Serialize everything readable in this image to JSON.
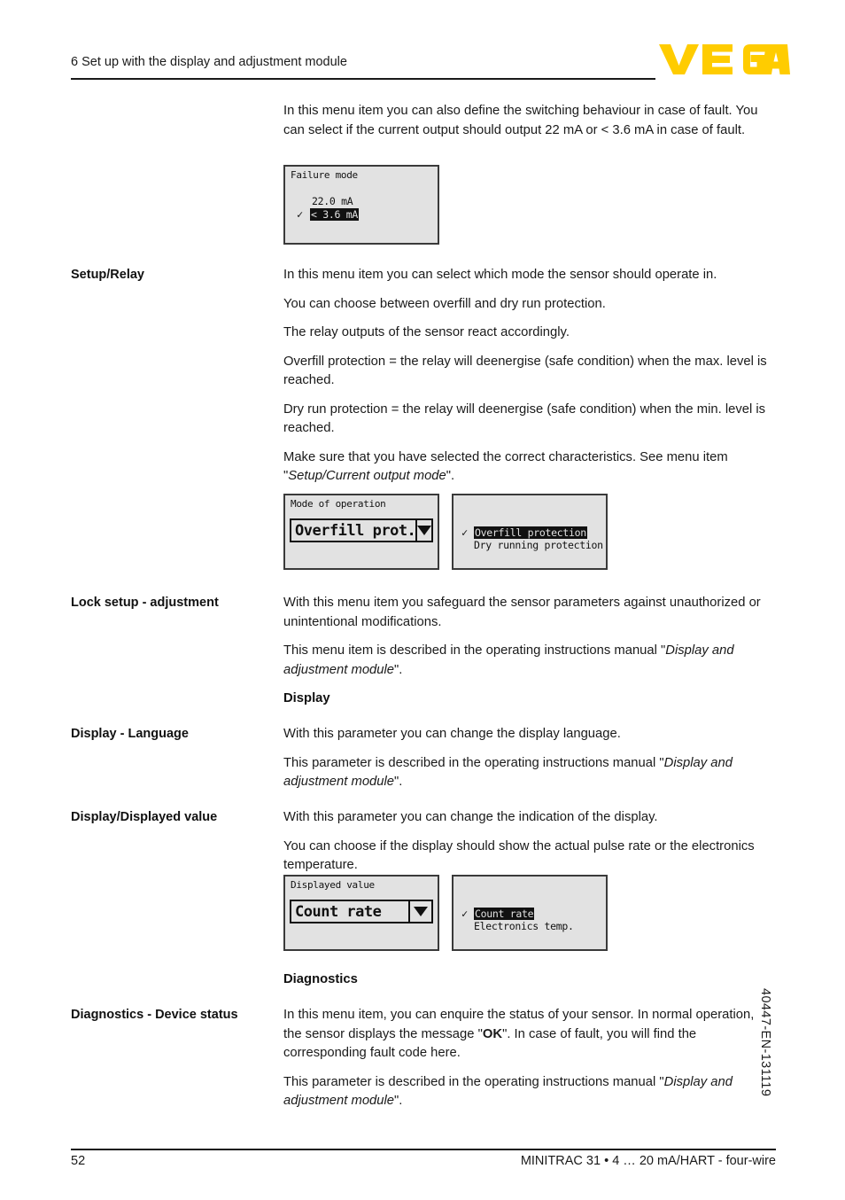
{
  "header": {
    "chapter_title": "6 Set up with the display and adjustment module",
    "logo_text": "VEGA",
    "logo_color": "#FFCC00"
  },
  "intro": {
    "paragraph": "In this menu item you can also define the switching behaviour in case of fault. You can select if the current output should output 22 mA or < 3.6 mA in case of fault."
  },
  "lcd_failure_mode": {
    "title": "Failure mode",
    "options": [
      {
        "label": "22.0 mA",
        "selected": false,
        "checked": false
      },
      {
        "label": "< 3.6 mA",
        "selected": true,
        "checked": true
      }
    ],
    "check_glyph": "✓"
  },
  "sections": [
    {
      "label": "Setup/Relay",
      "paragraphs": [
        "In this menu item you can select which mode the sensor should operate in.",
        "You can choose between overfill and dry run protection.",
        "The relay outputs of the sensor react accordingly.",
        "Overfill protection = the relay will deenergise (safe condition) when the max. level is reached.",
        "Dry run protection = the relay will deenergise (safe condition) when the min. level is reached.",
        "Make sure that you have selected the correct characteristics. See menu item \"Setup/Current output mode\"."
      ],
      "italic_phrase": "Setup/Current output mode"
    },
    {
      "label": "Lock setup - adjustment",
      "paragraphs": [
        "With this menu item you safeguard the sensor parameters against unauthorized or unintentional modifications.",
        "This menu item is described in the operating instructions manual \"Display and adjustment module\"."
      ],
      "italic_phrase": "Display and adjustment module"
    },
    {
      "label": "Display - Language",
      "paragraphs": [
        "With this parameter you can change the display language.",
        "This parameter is described in the operating instructions manual \"Display and adjustment module\"."
      ],
      "italic_phrase": "Display and adjustment module"
    },
    {
      "label": "Display/Displayed value",
      "paragraphs": [
        "With this parameter you can change the indication of the display.",
        "You can choose if the display should show the actual pulse rate or the electronics temperature."
      ]
    },
    {
      "label": "Diagnostics - Device status",
      "paragraphs": [
        "In this menu item, you can enquire the status of your sensor. In normal operation, the sensor displays the message \"OK\". In case of fault, you will find the corresponding fault code here.",
        "This parameter is described in the operating instructions manual \"Display and adjustment module\"."
      ],
      "bold_inline": "OK",
      "italic_phrase": "Display and adjustment module"
    }
  ],
  "subheads": {
    "display": "Display",
    "diagnostics": "Diagnostics"
  },
  "lcd_mode_of_operation": {
    "title": "Mode of operation",
    "field_value": "Overfill prot.",
    "arrow_icon": "chevron-down-icon"
  },
  "lcd_mode_list": {
    "options": [
      {
        "label": "Overfill protection",
        "selected": true,
        "checked": true
      },
      {
        "label": "Dry running protection",
        "selected": false,
        "checked": false
      }
    ],
    "check_glyph": "✓"
  },
  "lcd_displayed_value": {
    "title": "Displayed value",
    "field_value": "Count rate",
    "arrow_icon": "chevron-down-icon"
  },
  "lcd_displayed_value_list": {
    "options": [
      {
        "label": "Count rate",
        "selected": true,
        "checked": true
      },
      {
        "label": "Electronics temp.",
        "selected": false,
        "checked": false
      }
    ],
    "check_glyph": "✓"
  },
  "footer": {
    "page_number": "52",
    "document_line": "MINITRAC 31 • 4 … 20 mA/HART - four-wire",
    "side_code": "40447-EN-131119"
  }
}
